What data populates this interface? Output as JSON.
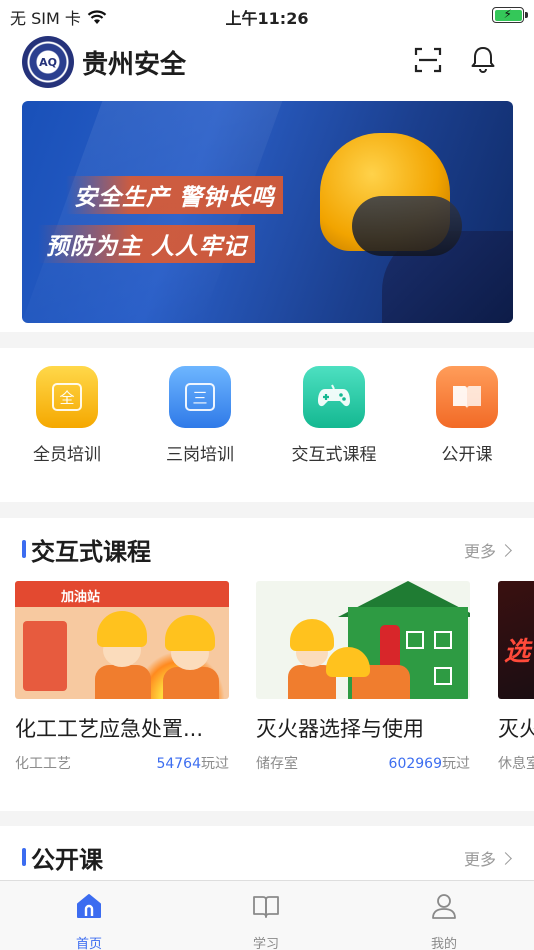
{
  "status_bar": {
    "carrier": "无 SIM 卡",
    "time": "上午11:26"
  },
  "header": {
    "app_title": "贵州安全",
    "logo_text": "AQ",
    "scan_icon": "scan-icon",
    "bell_icon": "bell-icon"
  },
  "banner": {
    "line1": "安全生产 警钟长鸣",
    "line2": "预防为主 人人牢记"
  },
  "quick_entries": [
    {
      "label": "全员培训",
      "icon": "全",
      "color": "#f5a800"
    },
    {
      "label": "三岗培训",
      "icon": "三",
      "color": "#2f7ae8"
    },
    {
      "label": "交互式课程",
      "icon": "gamepad-icon",
      "color": "#14b891"
    },
    {
      "label": "公开课",
      "icon": "book-icon",
      "color": "#f26a26"
    }
  ],
  "interactive_section": {
    "title": "交互式课程",
    "more": "更多",
    "cards": [
      {
        "title": "化工工艺应急处置...",
        "category": "化工工艺",
        "plays": "54764",
        "plays_unit": "玩过",
        "thumb_sign": "加油站"
      },
      {
        "title": "灭火器选择与使用",
        "category": "储存室",
        "plays": "602969",
        "plays_unit": "玩过"
      },
      {
        "title": "灭火",
        "category": "休息室",
        "thumb_text": "选"
      }
    ]
  },
  "open_section": {
    "title": "公开课",
    "more": "更多"
  },
  "tabbar": {
    "tabs": [
      {
        "label": "首页",
        "active": true
      },
      {
        "label": "学习",
        "active": false
      },
      {
        "label": "我的",
        "active": false
      }
    ]
  },
  "colors": {
    "accent": "#3c6cf0",
    "banner_blue": "#1950b8",
    "slogan_orange": "#e85a28"
  }
}
